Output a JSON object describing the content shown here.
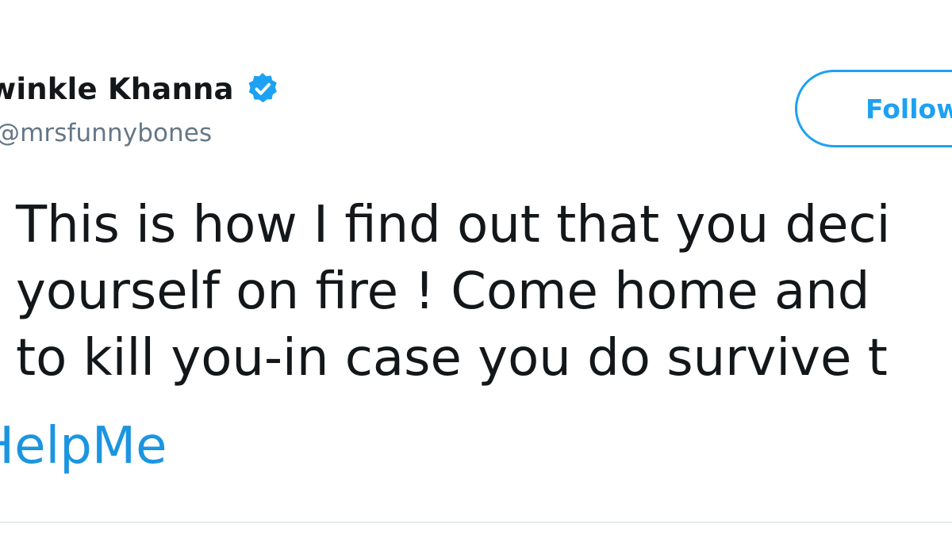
{
  "tweet": {
    "author": {
      "display_name": "winkle Khanna",
      "handle": "@mrsfunnybones",
      "verified": true
    },
    "follow_button": {
      "label": "Follow"
    },
    "text_lines": [
      "This is how I find out that you deci",
      "yourself on fire ! Come home and",
      "to kill you-in case you do survive t"
    ],
    "hashtag": "HelpMe"
  },
  "colors": {
    "accent": "#1da1f2",
    "link": "#1b95e0",
    "text": "#14171a",
    "secondary_text": "#657786",
    "divider": "#e6ecf0"
  },
  "icons": {
    "verified": "verified-badge-icon"
  }
}
